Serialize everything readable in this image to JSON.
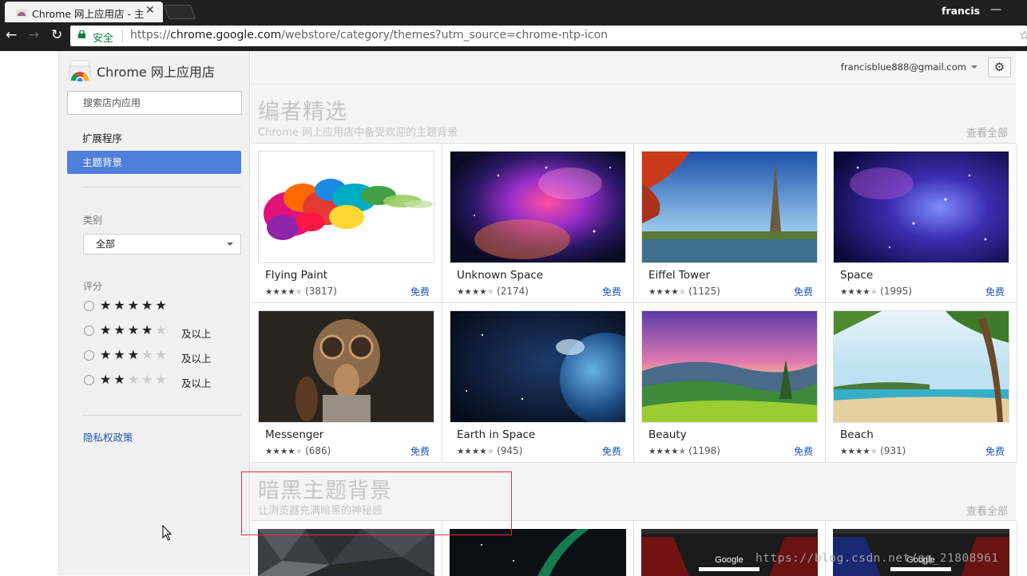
{
  "browser": {
    "tab_title": "Chrome 网上应用店 - 主",
    "profile_name": "francis",
    "minimize_glyph": "—",
    "secure_label": "安全",
    "url_scheme": "https://",
    "url_host": "chrome.google.com",
    "url_path": "/webstore/category/themes?utm_source=chrome-ntp-icon"
  },
  "sidebar": {
    "store_title": "Chrome 网上应用店",
    "search_placeholder": "搜索店内应用",
    "nav_extensions": "扩展程序",
    "nav_themes": "主题背景",
    "category_label": "类别",
    "category_value": "全部",
    "rating_label": "评分",
    "and_up": "及以上",
    "privacy_link": "隐私权政策"
  },
  "header": {
    "account_email": "francisblue888@gmail.com"
  },
  "sections": [
    {
      "title": "编者精选",
      "subtitle": "Chrome 网上应用店中备受欢迎的主题背景",
      "view_all": "查看全部"
    },
    {
      "title": "暗黑主题背景",
      "subtitle": "让浏览器充满暗黑的神秘感",
      "view_all": "查看全部"
    }
  ],
  "themes": [
    {
      "name": "Flying Paint",
      "rating": 4,
      "count": "(3817)",
      "price": "免费"
    },
    {
      "name": "Unknown Space",
      "rating": 4,
      "count": "(2174)",
      "price": "免费"
    },
    {
      "name": "Eiffel Tower",
      "rating": 4,
      "count": "(1125)",
      "price": "免费"
    },
    {
      "name": "Space",
      "rating": 4,
      "count": "(1995)",
      "price": "免费"
    },
    {
      "name": "Messenger",
      "rating": 4,
      "count": "(686)",
      "price": "免费"
    },
    {
      "name": "Earth in Space",
      "rating": 4,
      "count": "(945)",
      "price": "免费"
    },
    {
      "name": "Beauty",
      "rating": 4.5,
      "count": "(1198)",
      "price": "免费"
    },
    {
      "name": "Beach",
      "rating": 4,
      "count": "(931)",
      "price": "免费"
    }
  ],
  "dark_thumb_logo": "Google",
  "watermark": "https://blog.csdn.net/qq_21808961",
  "colors": {
    "accent_blue": "#4d7fdb",
    "link_blue": "#1a55c0",
    "secure_green": "#0b8043",
    "annotation_red": "#d9343a"
  }
}
